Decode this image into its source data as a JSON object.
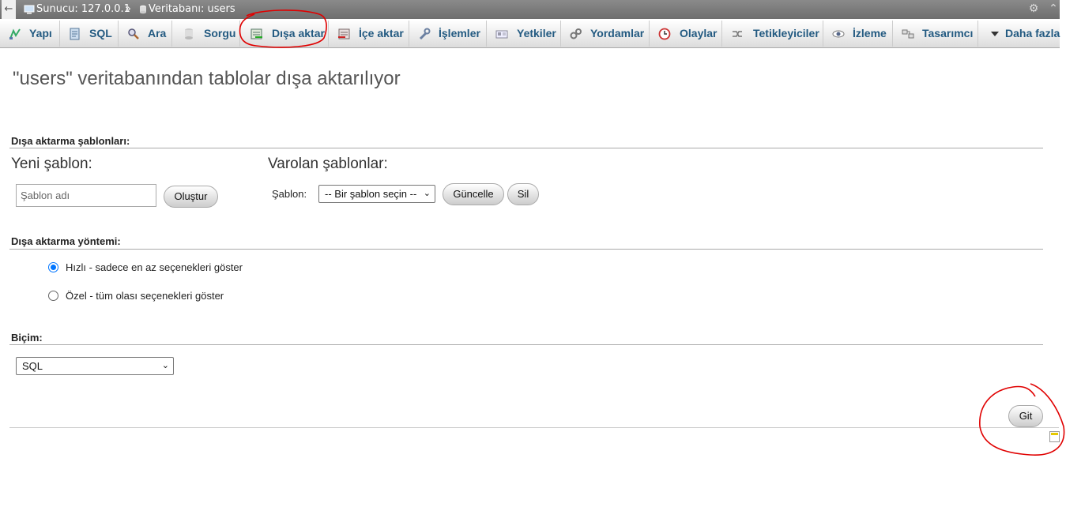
{
  "breadcrumb": {
    "back_icon": "back-arrow-icon",
    "server_label": "Sunucu: 127.0.0.1",
    "separator": "»",
    "database_label": "Veritabanı: users"
  },
  "tabs": [
    {
      "label": "Yapı",
      "icon": "structure-icon"
    },
    {
      "label": "SQL",
      "icon": "sql-icon"
    },
    {
      "label": "Ara",
      "icon": "search-icon"
    },
    {
      "label": "Sorgu",
      "icon": "query-icon"
    },
    {
      "label": "Dışa aktar",
      "icon": "export-icon"
    },
    {
      "label": "İçe aktar",
      "icon": "import-icon"
    },
    {
      "label": "İşlemler",
      "icon": "wrench-icon"
    },
    {
      "label": "Yetkiler",
      "icon": "privileges-icon"
    },
    {
      "label": "Yordamlar",
      "icon": "routines-icon"
    },
    {
      "label": "Olaylar",
      "icon": "clock-icon"
    },
    {
      "label": "Tetikleyiciler",
      "icon": "triggers-icon"
    },
    {
      "label": "İzleme",
      "icon": "eye-icon"
    },
    {
      "label": "Tasarımcı",
      "icon": "designer-icon"
    },
    {
      "label": "Daha fazla",
      "icon": "caret-down-icon"
    }
  ],
  "page_title": "\"users\" veritabanından tablolar dışa aktarılıyor",
  "templates": {
    "section_label": "Dışa aktarma şablonları:",
    "new_heading": "Yeni şablon:",
    "name_placeholder": "Şablon adı",
    "create_button": "Oluştur",
    "existing_heading": "Varolan şablonlar:",
    "template_label": "Şablon:",
    "template_select_value": "-- Bir şablon seçin --",
    "update_button": "Güncelle",
    "delete_button": "Sil"
  },
  "method": {
    "section_label": "Dışa aktarma yöntemi:",
    "options": [
      {
        "label": "Hızlı - sadece en az seçenekleri göster",
        "selected": true
      },
      {
        "label": "Özel - tüm olası seçenekleri göster",
        "selected": false
      }
    ]
  },
  "format": {
    "section_label": "Biçim:",
    "value": "SQL"
  },
  "go_button": "Git",
  "colors": {
    "tab_text": "#235a81",
    "annotation": "#e00000",
    "radio_accent": "#0075ff"
  }
}
